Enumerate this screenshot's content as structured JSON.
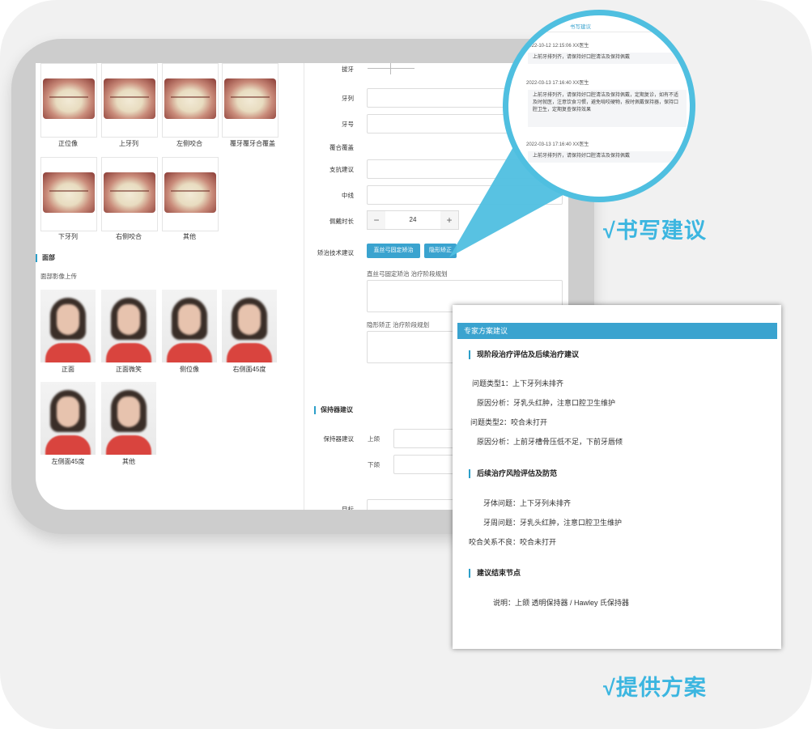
{
  "left_panel": {
    "intraoral_captions": [
      "正位像",
      "上牙列",
      "左侧咬合",
      "覆牙覆牙合覆盖",
      "下牙列",
      "右侧咬合",
      "其他"
    ],
    "face_section_title": "面部",
    "face_upload_hint": "面部影像上传",
    "face_captions": [
      "正面",
      "正面微笑",
      "侧位像",
      "右侧面45度",
      "左侧面45度",
      "其他"
    ]
  },
  "form": {
    "label_1": "拔牙",
    "label_2": "牙列",
    "label_3": "牙号",
    "label_4": "覆合覆盖",
    "label_5": "支抗建议",
    "label_6": "中线",
    "label_7": "佩戴时长",
    "stepper_value": "24",
    "stepper_minus": "−",
    "stepper_plus": "+",
    "label_8": "矫治技术建议",
    "tech_btn_1": "直丝弓固定矫治",
    "tech_btn_2": "隐形矫正",
    "tech_note_1": "直丝弓固定矫治 治疗阶段规划",
    "tech_note_2": "隐形矫正 治疗阶段规划",
    "retainer_title": "保持器建议",
    "retainer_label": "保持器建议",
    "upper": "上颌",
    "lower": "下颌",
    "target_label": "目标"
  },
  "zoom_circle": {
    "tab": "书写建议",
    "items": [
      {
        "time": "2022-10-12 12:15:06 XX医生",
        "text": "上前牙排列齐，请保持好口腔清洁及保持佩戴"
      },
      {
        "time": "2022-03-13 17:16:40 XX医生",
        "text": "上前牙排列齐，请保持好口腔清洁及保持佩戴，定期复诊，如有不适及时就医，注意饮食习惯，避免啃咬硬物，按时佩戴保持器，保持口腔卫生，定期复查保持效果"
      },
      {
        "time": "2022-03-13 17:16:40 XX医生",
        "text": "上前牙排列齐，请保持好口腔清洁及保持佩戴"
      }
    ]
  },
  "labels": {
    "write": "√书写建议",
    "provide": "√提供方案"
  },
  "expert_panel": {
    "header": "专家方案建议",
    "sec1": "现阶段治疗评估及后续治疗建议",
    "lines1": [
      "问题类型1：上下牙列未排齐",
      "原因分析：牙乳头红肿，注意口腔卫生维护",
      "问题类型2：咬合未打开",
      "原因分析：上前牙槽骨压低不足，下前牙唇倾"
    ],
    "sec2": "后续治疗风险评估及防范",
    "lines2": [
      "牙体问题：上下牙列未排齐",
      "牙周问题：牙乳头红肿，注意口腔卫生维护",
      "咬合关系不良：咬合未打开"
    ],
    "sec3": "建议结束节点",
    "lines3": [
      "说明：上颌 透明保持器 / Hawley 氏保持器"
    ]
  },
  "colors": {
    "accent": "#3aa3cf",
    "label_blue": "#3cb6e0"
  }
}
